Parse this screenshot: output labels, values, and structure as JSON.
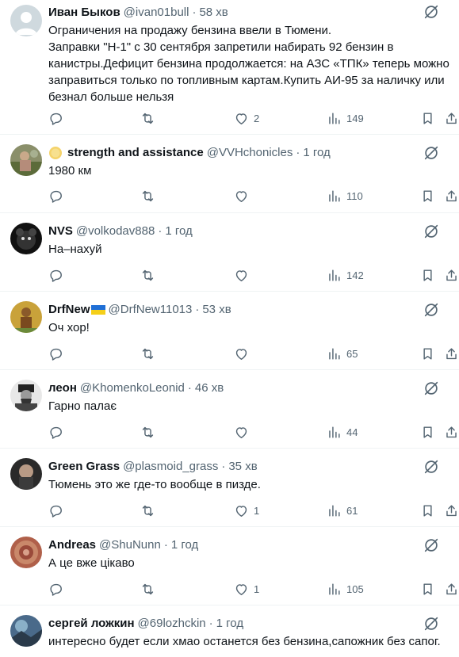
{
  "posts": [
    {
      "name": "Иван Быков",
      "handle": "@ivan01bull",
      "dot": "·",
      "time": "58 хв",
      "text": "Ограничения на продажу бензина ввели в Тюмени.\nЗаправки \"Н-1\" с 30 сентября запретили набирать 92 бензин в канистры.Дефицит бензина продолжается: на АЗС «ТПК» теперь можно заправиться только по топливным картам.Купить АИ-95 за наличку или безнал больше нельзя",
      "likes": "2",
      "views": "149"
    },
    {
      "name": "strength and assistance",
      "handle": "@VVHchonicles",
      "dot": "·",
      "time": "1 год",
      "text": "1980 км",
      "likes": "",
      "views": "110"
    },
    {
      "name": "NVS",
      "handle": "@volkodav888",
      "dot": "·",
      "time": "1 год",
      "text": "На–нахуй",
      "likes": "",
      "views": "142"
    },
    {
      "name": "DrfNew",
      "handle": "@DrfNew11013",
      "dot": "·",
      "time": "53 хв",
      "text": "Оч хор!",
      "likes": "",
      "views": "65"
    },
    {
      "name": "леон",
      "handle": "@KhomenkoLeonid",
      "dot": "·",
      "time": "46 хв",
      "text": "Гарно палає",
      "likes": "",
      "views": "44"
    },
    {
      "name": "Green Grass",
      "handle": "@plasmoid_grass",
      "dot": "·",
      "time": "35 хв",
      "text": "Тюмень это же где-то вообще в пизде.",
      "likes": "1",
      "views": "61"
    },
    {
      "name": "Andreas",
      "handle": "@ShuNunn",
      "dot": "·",
      "time": "1 год",
      "text": "А це вже цікаво",
      "likes": "1",
      "views": "105"
    },
    {
      "name": "сергей ложкин",
      "handle": "@69lozhckin",
      "dot": "·",
      "time": "1 год",
      "text": "интересно будет если хмао останется без бензина,сапожник без сапог.",
      "likes": "",
      "views": ""
    }
  ],
  "icons": {
    "reply": "reply-icon",
    "repost": "repost-icon",
    "like": "heart-icon",
    "views": "views-icon",
    "bookmark": "bookmark-icon",
    "share": "share-icon",
    "grok": "grok-icon",
    "flag": "ukraine-flag-icon",
    "sun": "sun-emoji-icon"
  },
  "colors": {
    "text": "#0f1419",
    "secondary": "#536471",
    "divider": "#eff3f4"
  }
}
